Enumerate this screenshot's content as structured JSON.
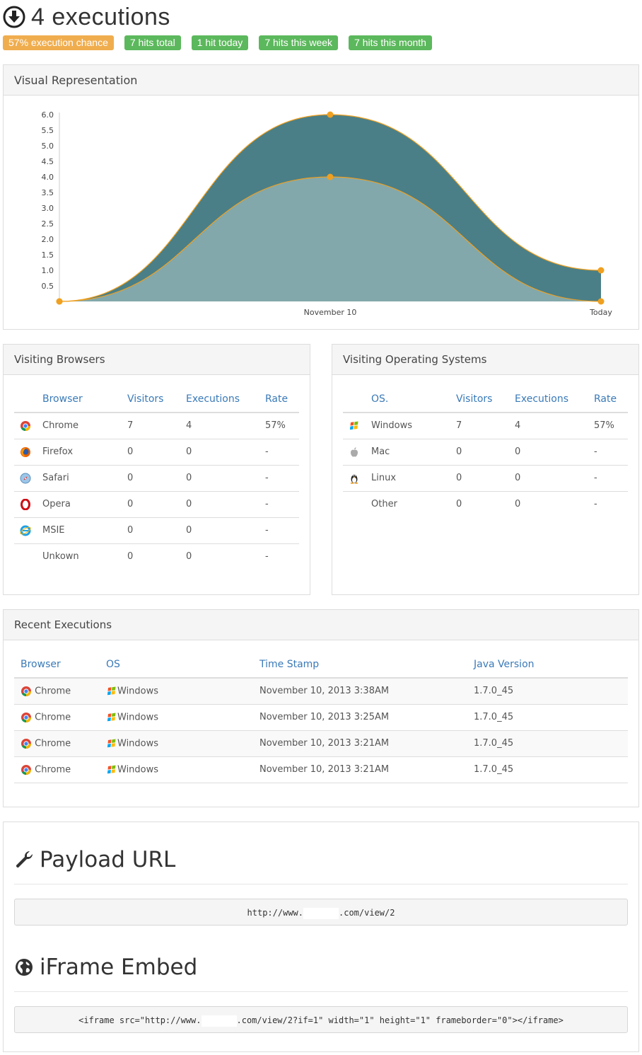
{
  "header": {
    "title": "4 executions",
    "icon": "download-circle-icon"
  },
  "badges": [
    {
      "label": "57% execution chance",
      "color": "#f0ad4e"
    },
    {
      "label": "7 hits total",
      "color": "#5cb85c"
    },
    {
      "label": "1 hit today",
      "color": "#5cb85c"
    },
    {
      "label": "7 hits this week",
      "color": "#5cb85c"
    },
    {
      "label": "7 hits this month",
      "color": "#5cb85c"
    }
  ],
  "visual": {
    "heading": "Visual Representation"
  },
  "chart_data": {
    "type": "area",
    "categories": [
      "",
      "November 10",
      "Today"
    ],
    "yticks": [
      "0.5",
      "1.0",
      "1.5",
      "2.0",
      "2.5",
      "3.0",
      "3.5",
      "4.0",
      "4.5",
      "5.0",
      "5.5",
      "6.0"
    ],
    "ylim": [
      0,
      6.0
    ],
    "grid": false,
    "series": [
      {
        "values": [
          0,
          6,
          1
        ],
        "color": "#4a7f87"
      },
      {
        "values": [
          0,
          4,
          0
        ],
        "color": "#82a8ab"
      }
    ],
    "point_color": "#f0a020"
  },
  "browsers": {
    "heading": "Visiting Browsers",
    "columns": [
      "Browser",
      "Visitors",
      "Executions",
      "Rate"
    ],
    "rows": [
      {
        "icon": "chrome-icon",
        "name": "Chrome",
        "visitors": "7",
        "executions": "4",
        "rate": "57%"
      },
      {
        "icon": "firefox-icon",
        "name": "Firefox",
        "visitors": "0",
        "executions": "0",
        "rate": "-"
      },
      {
        "icon": "safari-icon",
        "name": "Safari",
        "visitors": "0",
        "executions": "0",
        "rate": "-"
      },
      {
        "icon": "opera-icon",
        "name": "Opera",
        "visitors": "0",
        "executions": "0",
        "rate": "-"
      },
      {
        "icon": "ie-icon",
        "name": "MSIE",
        "visitors": "0",
        "executions": "0",
        "rate": "-"
      },
      {
        "icon": "",
        "name": "Unkown",
        "visitors": "0",
        "executions": "0",
        "rate": "-"
      }
    ]
  },
  "os": {
    "heading": "Visiting Operating Systems",
    "columns": [
      "OS.",
      "Visitors",
      "Executions",
      "Rate"
    ],
    "rows": [
      {
        "icon": "windows-icon",
        "name": "Windows",
        "visitors": "7",
        "executions": "4",
        "rate": "57%"
      },
      {
        "icon": "apple-icon",
        "name": "Mac",
        "visitors": "0",
        "executions": "0",
        "rate": "-"
      },
      {
        "icon": "linux-icon",
        "name": "Linux",
        "visitors": "0",
        "executions": "0",
        "rate": "-"
      },
      {
        "icon": "",
        "name": "Other",
        "visitors": "0",
        "executions": "0",
        "rate": "-"
      }
    ]
  },
  "recent": {
    "heading": "Recent Executions",
    "columns": [
      "Browser",
      "OS",
      "Time Stamp",
      "Java Version"
    ],
    "rows": [
      {
        "browser": "Chrome",
        "os": "Windows",
        "time": "November 10, 2013 3:38AM",
        "java": "1.7.0_45"
      },
      {
        "browser": "Chrome",
        "os": "Windows",
        "time": "November 10, 2013 3:25AM",
        "java": "1.7.0_45"
      },
      {
        "browser": "Chrome",
        "os": "Windows",
        "time": "November 10, 2013 3:21AM",
        "java": "1.7.0_45"
      },
      {
        "browser": "Chrome",
        "os": "Windows",
        "time": "November 10, 2013 3:21AM",
        "java": "1.7.0_45"
      }
    ]
  },
  "payload": {
    "title": "Payload URL",
    "icon": "wrench-icon",
    "url_prefix": "http://www.",
    "url_suffix": ".com/view/2"
  },
  "iframe": {
    "title": "iFrame Embed",
    "icon": "globe-icon",
    "code_prefix": "<iframe src=\"http://www.",
    "code_suffix": ".com/view/2?if=1\" width=\"1\" height=\"1\" frameborder=\"0\"></iframe>"
  }
}
